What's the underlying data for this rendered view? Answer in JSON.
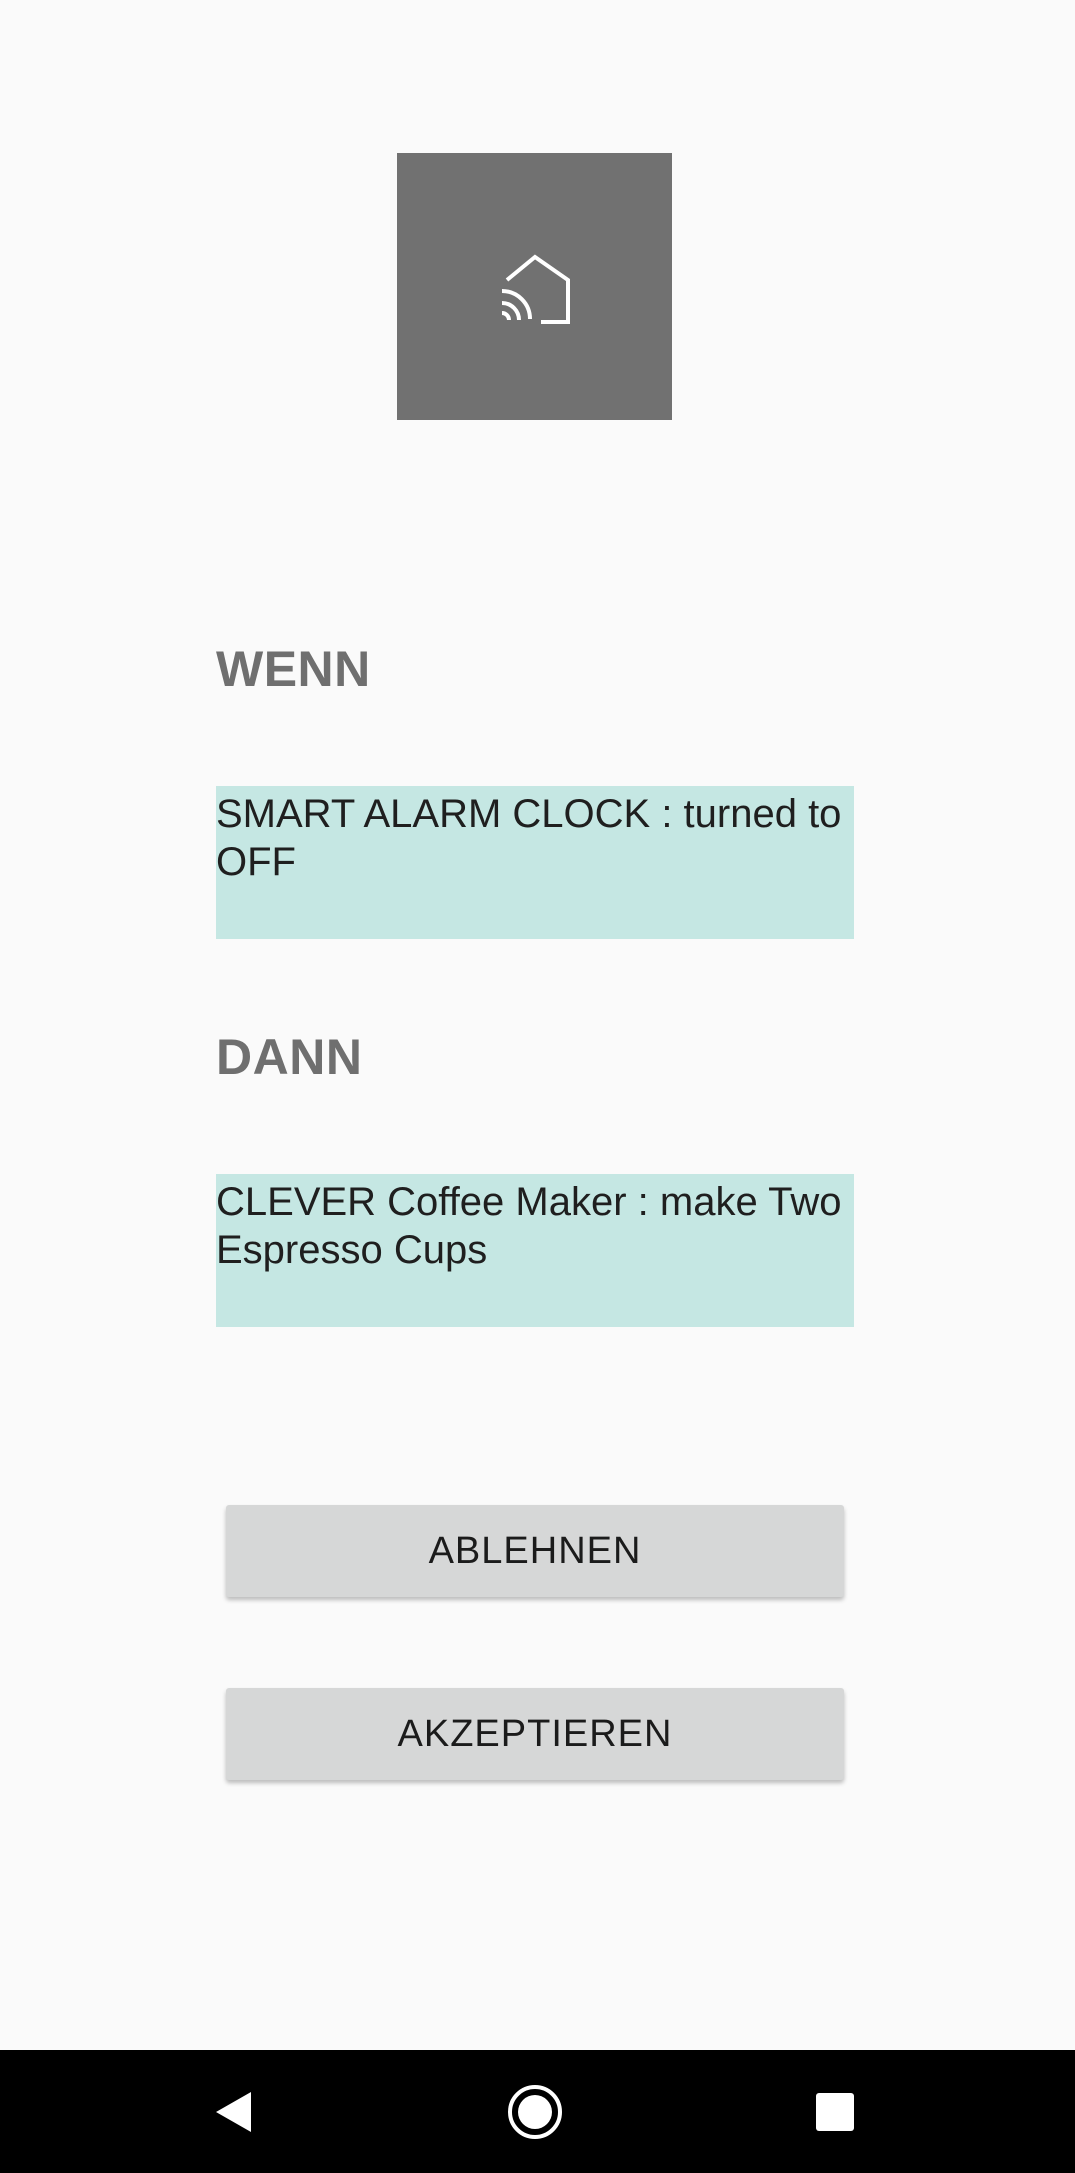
{
  "app_icon": {
    "icon": "smart-home-icon",
    "background": "#717171"
  },
  "rule": {
    "if_heading": "WENN",
    "if_condition": "SMART ALARM CLOCK : turned to OFF",
    "then_heading": "DANN",
    "then_action": "CLEVER Coffee Maker : make Two Espresso Cups",
    "box_color": "#c5e7e3"
  },
  "buttons": {
    "decline_label": "ABLEHNEN",
    "accept_label": "AKZEPTIEREN"
  },
  "nav_bar": {
    "back_icon": "back-triangle-icon",
    "home_icon": "home-circle-icon",
    "recents_icon": "recents-square-icon"
  }
}
